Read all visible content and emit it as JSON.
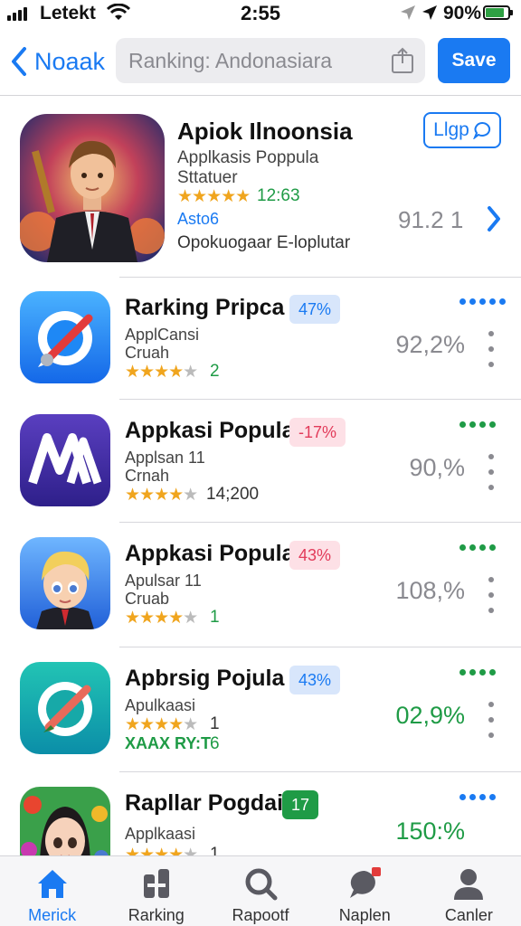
{
  "status": {
    "carrier": "Letekt",
    "time": "2:55",
    "battery": "90%"
  },
  "nav": {
    "back_label": "Noaak",
    "search_text": "Ranking: Andonasiara",
    "save_label": "Save"
  },
  "featured": {
    "title": "Apiok Ilnoonsia",
    "subtitle1": "Applkasis Poppula",
    "subtitle2": "Sttatuer",
    "stars": "★★★★★",
    "rating": "12:63",
    "link": "Asto6",
    "description": "Opokuogaar E-loplutar",
    "percent": "91.2 1",
    "login_label": "Llgp"
  },
  "apps": [
    {
      "title": "Rarking Pripca",
      "badge": "47%",
      "sub1": "ApplCansi",
      "sub2": "Cruah",
      "stars": "★★★★",
      "stars_empty": "★",
      "count": "2",
      "percent": "92,2%",
      "dots_color": "#1a7af2"
    },
    {
      "title": "Appkasi Popula",
      "badge": "-17%",
      "sub1": "Applsan 11",
      "sub2": "Crnah",
      "stars": "★★★★",
      "stars_empty": "★",
      "count": "14;200",
      "percent": "90,%",
      "dots_color": "#1f9b46"
    },
    {
      "title": "Appkasi Popula",
      "badge": "43%",
      "sub1": "Apulsar 11",
      "sub2": "Cruab",
      "stars": "★★★★",
      "stars_empty": "★",
      "count": "1",
      "percent": "108,%",
      "dots_color": "#1f9b46"
    },
    {
      "title": "Apbrsig Pojula",
      "badge": "43%",
      "sub1": "Apulkaasi",
      "sub2": "XAAX RY:T",
      "stars": "★★★★",
      "stars_empty": "★",
      "count": "1",
      "extra": "6",
      "percent": "02,9%",
      "dots_color": "#1f9b46"
    },
    {
      "title": "Rapllar Pogdain",
      "badge": "17",
      "sub1": "Applkaasi",
      "sub2": "",
      "stars": "★★★★",
      "stars_empty": "★",
      "count": "1",
      "percent": "150:%",
      "dots_color": "#1a7af2"
    }
  ],
  "tabs": [
    {
      "label": "Merick",
      "icon": "home-icon",
      "active": true
    },
    {
      "label": "Rarking",
      "icon": "ranking-icon",
      "active": false
    },
    {
      "label": "Rapootf",
      "icon": "search-icon",
      "active": false
    },
    {
      "label": "Naplen",
      "icon": "chat-icon",
      "active": false
    },
    {
      "label": "Canler",
      "icon": "profile-icon",
      "active": false
    }
  ],
  "colors": {
    "accent": "#1a7af2",
    "positive": "#1f9b46",
    "star": "#f0a51e",
    "badge_blue": "#d8e6fb",
    "badge_pink": "#fde0e6",
    "badge_green": "#1f9b46"
  }
}
